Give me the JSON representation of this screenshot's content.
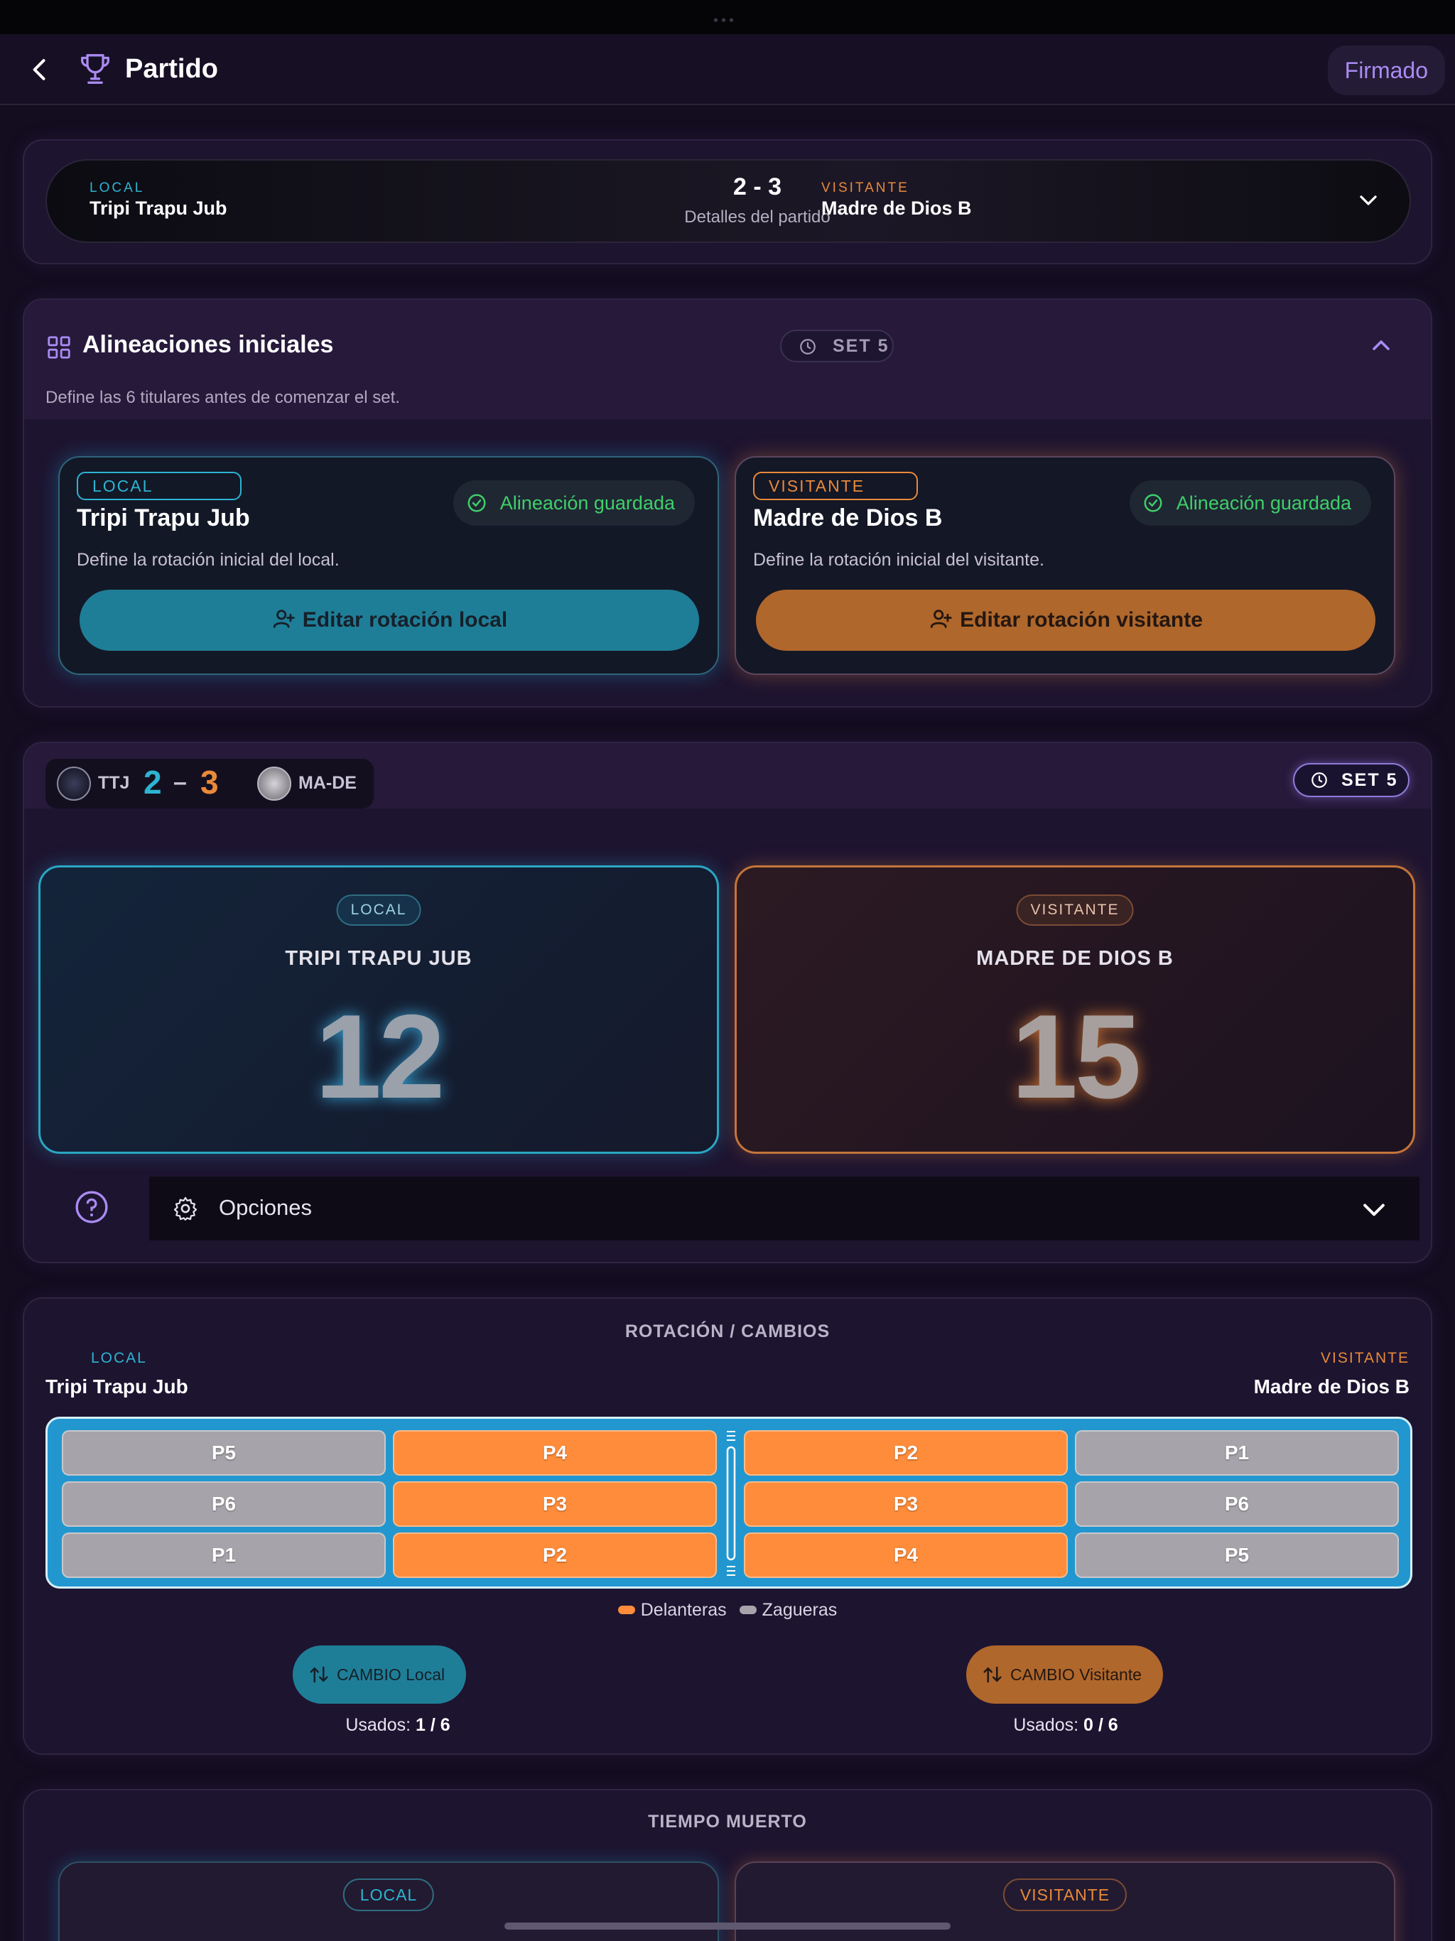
{
  "header": {
    "title": "Partido",
    "signed_label": "Firmado"
  },
  "match": {
    "home_tag": "LOCAL",
    "home_name": "Tripi Trapu Jub",
    "score": "2 - 3",
    "details": "Detalles del partido",
    "away_tag": "VISITANTE",
    "away_name": "Madre de Dios B"
  },
  "lineups": {
    "title": "Alineaciones iniciales",
    "set_label": "SET 5",
    "subtitle": "Define las 6 titulares antes de comenzar el set.",
    "home": {
      "badge": "LOCAL",
      "name": "Tripi Trapu Jub",
      "status": "Alineación guardada",
      "desc": "Define la rotación inicial del local.",
      "button": "Editar rotación local"
    },
    "away": {
      "badge": "VISITANTE",
      "name": "Madre de Dios B",
      "status": "Alineación guardada",
      "desc": "Define la rotación inicial del visitante.",
      "button": "Editar rotación visitante"
    }
  },
  "scoreboard": {
    "home_abbr": "TTJ",
    "home_sets": "2",
    "dash": "–",
    "away_sets": "3",
    "away_abbr": "MA-DE",
    "set_label": "SET 5",
    "home": {
      "chip": "LOCAL",
      "name": "TRIPI TRAPU JUB",
      "points": "12"
    },
    "away": {
      "chip": "VISITANTE",
      "name": "MADRE DE DIOS B",
      "points": "15"
    },
    "options_label": "Opciones"
  },
  "rotation": {
    "title": "ROTACIÓN / CAMBIOS",
    "home_tag": "LOCAL",
    "home_name": "Tripi Trapu Jub",
    "away_tag": "VISITANTE",
    "away_name": "Madre de Dios B",
    "home_back": [
      "P5",
      "P6",
      "P1"
    ],
    "home_front": [
      "P4",
      "P3",
      "P2"
    ],
    "away_front": [
      "P2",
      "P3",
      "P4"
    ],
    "away_back": [
      "P1",
      "P6",
      "P5"
    ],
    "legend_front": "Delanteras",
    "legend_back": "Zagueras",
    "home_change_button": "CAMBIO Local",
    "away_change_button": "CAMBIO Visitante",
    "used_label": "Usados:",
    "home_used": "1 / 6",
    "away_used": "0 / 6",
    "colors": {
      "front": "#ff8c3a",
      "back": "#a6a4aa",
      "court": "#2297cf"
    }
  },
  "timeout": {
    "title": "TIEMPO MUERTO",
    "home_chip": "LOCAL",
    "away_chip": "VISITANTE"
  },
  "colors": {
    "accent": "#a98bf2",
    "home": "#2db4d2",
    "away": "#e98a3a",
    "success": "#3fcf6a"
  }
}
